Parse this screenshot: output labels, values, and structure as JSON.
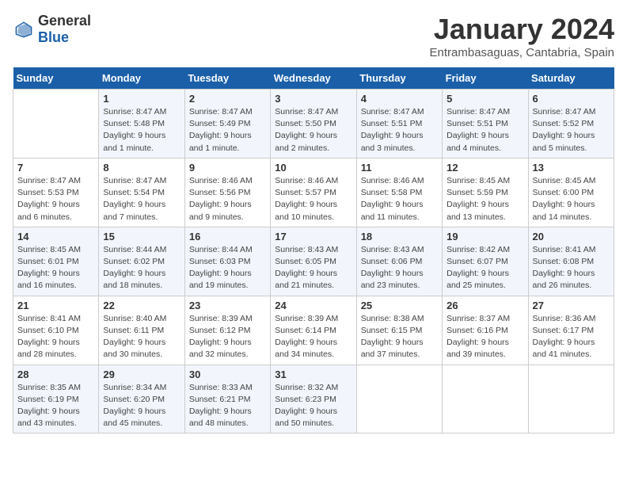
{
  "logo": {
    "general": "General",
    "blue": "Blue"
  },
  "header": {
    "month": "January 2024",
    "location": "Entrambasaguas, Cantabria, Spain"
  },
  "weekdays": [
    "Sunday",
    "Monday",
    "Tuesday",
    "Wednesday",
    "Thursday",
    "Friday",
    "Saturday"
  ],
  "weeks": [
    [
      {
        "day": "",
        "info": ""
      },
      {
        "day": "1",
        "info": "Sunrise: 8:47 AM\nSunset: 5:48 PM\nDaylight: 9 hours\nand 1 minute."
      },
      {
        "day": "2",
        "info": "Sunrise: 8:47 AM\nSunset: 5:49 PM\nDaylight: 9 hours\nand 1 minute."
      },
      {
        "day": "3",
        "info": "Sunrise: 8:47 AM\nSunset: 5:50 PM\nDaylight: 9 hours\nand 2 minutes."
      },
      {
        "day": "4",
        "info": "Sunrise: 8:47 AM\nSunset: 5:51 PM\nDaylight: 9 hours\nand 3 minutes."
      },
      {
        "day": "5",
        "info": "Sunrise: 8:47 AM\nSunset: 5:51 PM\nDaylight: 9 hours\nand 4 minutes."
      },
      {
        "day": "6",
        "info": "Sunrise: 8:47 AM\nSunset: 5:52 PM\nDaylight: 9 hours\nand 5 minutes."
      }
    ],
    [
      {
        "day": "7",
        "info": "Sunrise: 8:47 AM\nSunset: 5:53 PM\nDaylight: 9 hours\nand 6 minutes."
      },
      {
        "day": "8",
        "info": "Sunrise: 8:47 AM\nSunset: 5:54 PM\nDaylight: 9 hours\nand 7 minutes."
      },
      {
        "day": "9",
        "info": "Sunrise: 8:46 AM\nSunset: 5:56 PM\nDaylight: 9 hours\nand 9 minutes."
      },
      {
        "day": "10",
        "info": "Sunrise: 8:46 AM\nSunset: 5:57 PM\nDaylight: 9 hours\nand 10 minutes."
      },
      {
        "day": "11",
        "info": "Sunrise: 8:46 AM\nSunset: 5:58 PM\nDaylight: 9 hours\nand 11 minutes."
      },
      {
        "day": "12",
        "info": "Sunrise: 8:45 AM\nSunset: 5:59 PM\nDaylight: 9 hours\nand 13 minutes."
      },
      {
        "day": "13",
        "info": "Sunrise: 8:45 AM\nSunset: 6:00 PM\nDaylight: 9 hours\nand 14 minutes."
      }
    ],
    [
      {
        "day": "14",
        "info": "Sunrise: 8:45 AM\nSunset: 6:01 PM\nDaylight: 9 hours\nand 16 minutes."
      },
      {
        "day": "15",
        "info": "Sunrise: 8:44 AM\nSunset: 6:02 PM\nDaylight: 9 hours\nand 18 minutes."
      },
      {
        "day": "16",
        "info": "Sunrise: 8:44 AM\nSunset: 6:03 PM\nDaylight: 9 hours\nand 19 minutes."
      },
      {
        "day": "17",
        "info": "Sunrise: 8:43 AM\nSunset: 6:05 PM\nDaylight: 9 hours\nand 21 minutes."
      },
      {
        "day": "18",
        "info": "Sunrise: 8:43 AM\nSunset: 6:06 PM\nDaylight: 9 hours\nand 23 minutes."
      },
      {
        "day": "19",
        "info": "Sunrise: 8:42 AM\nSunset: 6:07 PM\nDaylight: 9 hours\nand 25 minutes."
      },
      {
        "day": "20",
        "info": "Sunrise: 8:41 AM\nSunset: 6:08 PM\nDaylight: 9 hours\nand 26 minutes."
      }
    ],
    [
      {
        "day": "21",
        "info": "Sunrise: 8:41 AM\nSunset: 6:10 PM\nDaylight: 9 hours\nand 28 minutes."
      },
      {
        "day": "22",
        "info": "Sunrise: 8:40 AM\nSunset: 6:11 PM\nDaylight: 9 hours\nand 30 minutes."
      },
      {
        "day": "23",
        "info": "Sunrise: 8:39 AM\nSunset: 6:12 PM\nDaylight: 9 hours\nand 32 minutes."
      },
      {
        "day": "24",
        "info": "Sunrise: 8:39 AM\nSunset: 6:14 PM\nDaylight: 9 hours\nand 34 minutes."
      },
      {
        "day": "25",
        "info": "Sunrise: 8:38 AM\nSunset: 6:15 PM\nDaylight: 9 hours\nand 37 minutes."
      },
      {
        "day": "26",
        "info": "Sunrise: 8:37 AM\nSunset: 6:16 PM\nDaylight: 9 hours\nand 39 minutes."
      },
      {
        "day": "27",
        "info": "Sunrise: 8:36 AM\nSunset: 6:17 PM\nDaylight: 9 hours\nand 41 minutes."
      }
    ],
    [
      {
        "day": "28",
        "info": "Sunrise: 8:35 AM\nSunset: 6:19 PM\nDaylight: 9 hours\nand 43 minutes."
      },
      {
        "day": "29",
        "info": "Sunrise: 8:34 AM\nSunset: 6:20 PM\nDaylight: 9 hours\nand 45 minutes."
      },
      {
        "day": "30",
        "info": "Sunrise: 8:33 AM\nSunset: 6:21 PM\nDaylight: 9 hours\nand 48 minutes."
      },
      {
        "day": "31",
        "info": "Sunrise: 8:32 AM\nSunset: 6:23 PM\nDaylight: 9 hours\nand 50 minutes."
      },
      {
        "day": "",
        "info": ""
      },
      {
        "day": "",
        "info": ""
      },
      {
        "day": "",
        "info": ""
      }
    ]
  ]
}
